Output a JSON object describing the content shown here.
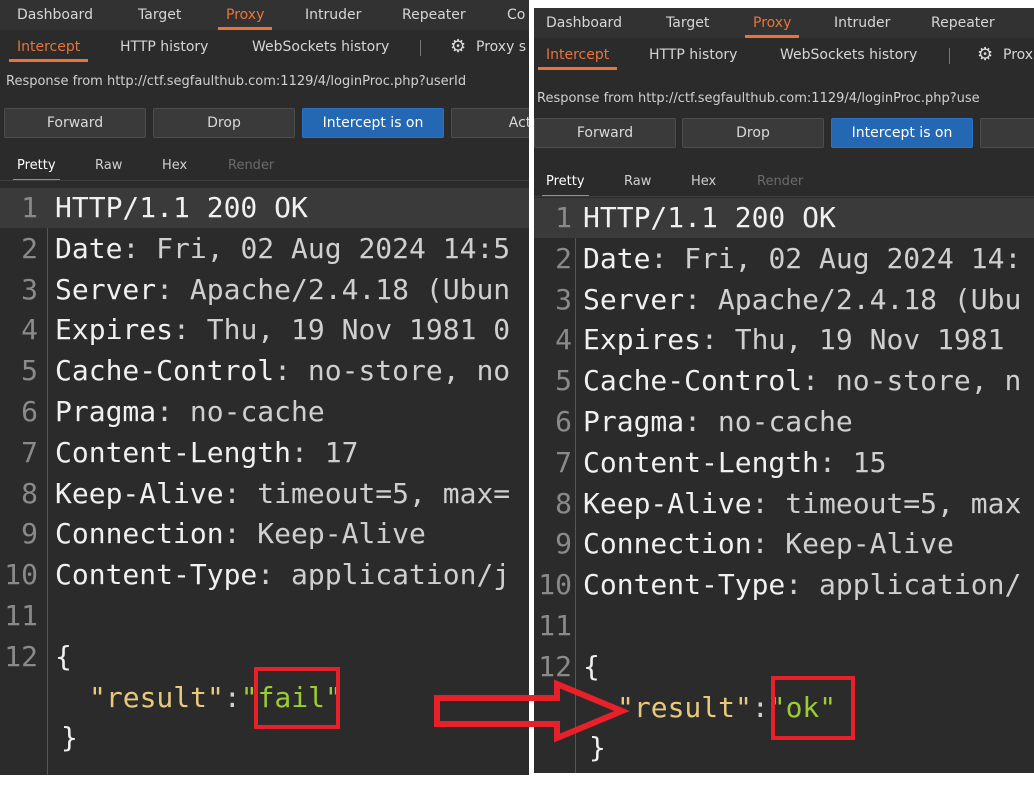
{
  "colors": {
    "accent": "#e8743b",
    "intercept_on": "#2468b3",
    "annotation": "#e8202a",
    "string_key": "#e8c87a",
    "string_value": "#9acd32"
  },
  "left": {
    "top_tabs": [
      "Dashboard",
      "Target",
      "Proxy",
      "Intruder",
      "Repeater",
      "Co"
    ],
    "sub_tabs": [
      "Intercept",
      "HTTP history",
      "WebSockets history",
      "Proxy s"
    ],
    "gear_icon": "gear-icon",
    "response_from": "Response from http://ctf.segfaulthub.com:1129/4/loginProc.php?userId",
    "buttons": [
      "Forward",
      "Drop",
      "Intercept is on",
      "Acti"
    ],
    "view_tabs": [
      "Pretty",
      "Raw",
      "Hex",
      "Render"
    ],
    "lines": [
      {
        "n": "1",
        "name": "HTTP/1.1 200 OK",
        "sep": "",
        "val": ""
      },
      {
        "n": "2",
        "name": "Date",
        "sep": ": ",
        "val": "Fri, 02 Aug 2024 14:5"
      },
      {
        "n": "3",
        "name": "Server",
        "sep": ": ",
        "val": "Apache/2.4.18 (Ubun"
      },
      {
        "n": "4",
        "name": "Expires",
        "sep": ": ",
        "val": "Thu, 19 Nov 1981 0"
      },
      {
        "n": "5",
        "name": "Cache-Control",
        "sep": ": ",
        "val": "no-store, no"
      },
      {
        "n": "6",
        "name": "Pragma",
        "sep": ": ",
        "val": "no-cache"
      },
      {
        "n": "7",
        "name": "Content-Length",
        "sep": ": ",
        "val": "17"
      },
      {
        "n": "8",
        "name": "Keep-Alive",
        "sep": ": ",
        "val": "timeout=5, max="
      },
      {
        "n": "9",
        "name": "Connection",
        "sep": ": ",
        "val": "Keep-Alive"
      },
      {
        "n": "10",
        "name": "Content-Type",
        "sep": ": ",
        "val": "application/j"
      },
      {
        "n": "11",
        "name": "",
        "sep": "",
        "val": ""
      },
      {
        "n": "12",
        "name": "{",
        "sep": "",
        "val": ""
      }
    ],
    "json_key": "\"result\"",
    "json_colon": ":",
    "json_value": "\"fail\"",
    "closing_brace": "}"
  },
  "right": {
    "top_tabs": [
      "Dashboard",
      "Target",
      "Proxy",
      "Intruder",
      "Repeater"
    ],
    "sub_tabs": [
      "Intercept",
      "HTTP history",
      "WebSockets history",
      "Prox"
    ],
    "gear_icon": "gear-icon",
    "response_from": "Response from http://ctf.segfaulthub.com:1129/4/loginProc.php?use",
    "buttons": [
      "Forward",
      "Drop",
      "Intercept is on",
      "A"
    ],
    "view_tabs": [
      "Pretty",
      "Raw",
      "Hex",
      "Render"
    ],
    "lines": [
      {
        "n": "1",
        "name": "HTTP/1.1 200 OK",
        "sep": "",
        "val": ""
      },
      {
        "n": "2",
        "name": "Date",
        "sep": ": ",
        "val": "Fri, 02 Aug 2024 14:"
      },
      {
        "n": "3",
        "name": "Server",
        "sep": ": ",
        "val": "Apache/2.4.18 (Ubu"
      },
      {
        "n": "4",
        "name": "Expires",
        "sep": ": ",
        "val": "Thu, 19 Nov 1981"
      },
      {
        "n": "5",
        "name": "Cache-Control",
        "sep": ": ",
        "val": "no-store, n"
      },
      {
        "n": "6",
        "name": "Pragma",
        "sep": ": ",
        "val": "no-cache"
      },
      {
        "n": "7",
        "name": "Content-Length",
        "sep": ": ",
        "val": "15"
      },
      {
        "n": "8",
        "name": "Keep-Alive",
        "sep": ": ",
        "val": "timeout=5, max"
      },
      {
        "n": "9",
        "name": "Connection",
        "sep": ": ",
        "val": "Keep-Alive"
      },
      {
        "n": "10",
        "name": "Content-Type",
        "sep": ": ",
        "val": "application/"
      },
      {
        "n": "11",
        "name": "",
        "sep": "",
        "val": ""
      },
      {
        "n": "12",
        "name": "{",
        "sep": "",
        "val": ""
      }
    ],
    "json_key": "\"result\"",
    "json_colon": ":",
    "json_value": "\"ok\"",
    "closing_brace": "}"
  }
}
